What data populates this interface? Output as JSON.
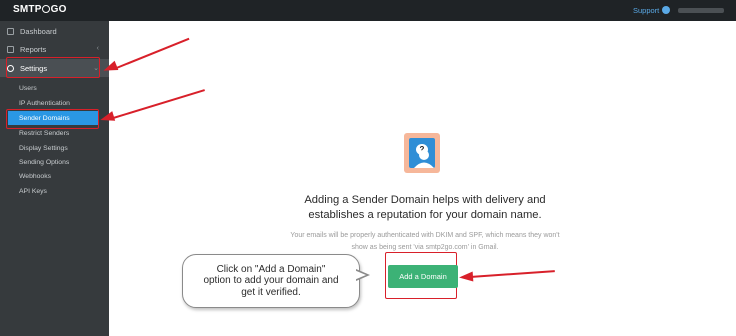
{
  "header": {
    "logo_left": "SMTP",
    "logo_right": "GO",
    "support_label": "Support"
  },
  "sidebar": {
    "items": [
      {
        "label": "Dashboard"
      },
      {
        "label": "Reports"
      },
      {
        "label": "Settings"
      }
    ],
    "subitems": [
      {
        "label": "Users"
      },
      {
        "label": "IP Authentication"
      },
      {
        "label": "Sender Domains"
      },
      {
        "label": "Restrict Senders"
      },
      {
        "label": "Display Settings"
      },
      {
        "label": "Sending Options"
      },
      {
        "label": "Webhooks"
      },
      {
        "label": "API Keys"
      }
    ]
  },
  "main": {
    "stamp_symbol": "?",
    "headline": "Adding a Sender Domain helps with delivery and establishes a reputation for your domain name.",
    "subtext": "Your emails will be properly authenticated with DKIM and SPF, which means they won't show as being sent 'via smtp2go.com' in Gmail.",
    "add_button": "Add a Domain"
  },
  "annotation": {
    "callout": "Click on \"Add a Domain\"\noption to add your domain and\nget it verified."
  },
  "colors": {
    "accent": "#2a97e4",
    "button": "#3cb276",
    "annotation": "#d8202a"
  }
}
